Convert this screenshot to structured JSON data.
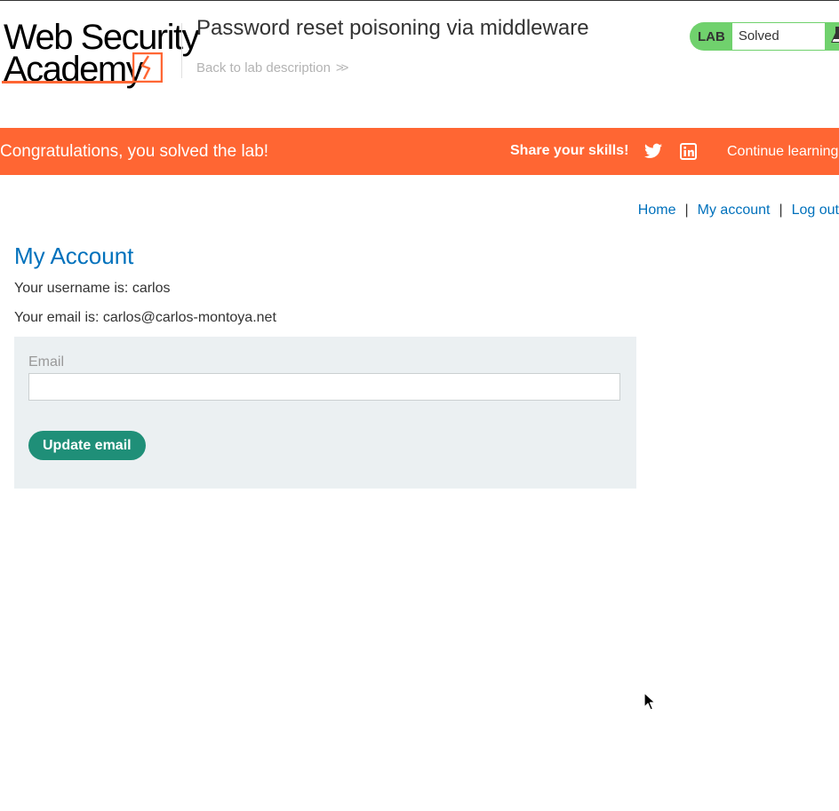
{
  "header": {
    "logo_line1": "Web Security",
    "logo_line2": "Academy",
    "lab_title": "Password reset poisoning via middleware",
    "back_link": "Back to lab description",
    "lab_badge": "LAB",
    "lab_status": "Solved"
  },
  "banner": {
    "message": "Congratulations, you solved the lab!",
    "share_label": "Share your skills!",
    "continue_label": "Continue learning"
  },
  "nav": {
    "home": "Home",
    "separator": "|",
    "my_account": "My account",
    "log_out": "Log out"
  },
  "account": {
    "title": "My Account",
    "username_line": "Your username is: carlos",
    "email_line": "Your email is: carlos@carlos-montoya.net",
    "email_label": "Email",
    "email_value": "",
    "submit_label": "Update email"
  },
  "colors": {
    "brand_orange": "#ff6633",
    "lab_green": "#70d16d",
    "link_blue": "#0071bc",
    "button_green": "#1f8f78",
    "form_bg": "#ebf0f2"
  },
  "icons": {
    "back": "double-chevron-right-icon",
    "flask": "flask-icon",
    "twitter": "twitter-icon",
    "linkedin": "linkedin-icon",
    "cursor": "mouse-pointer-icon"
  }
}
